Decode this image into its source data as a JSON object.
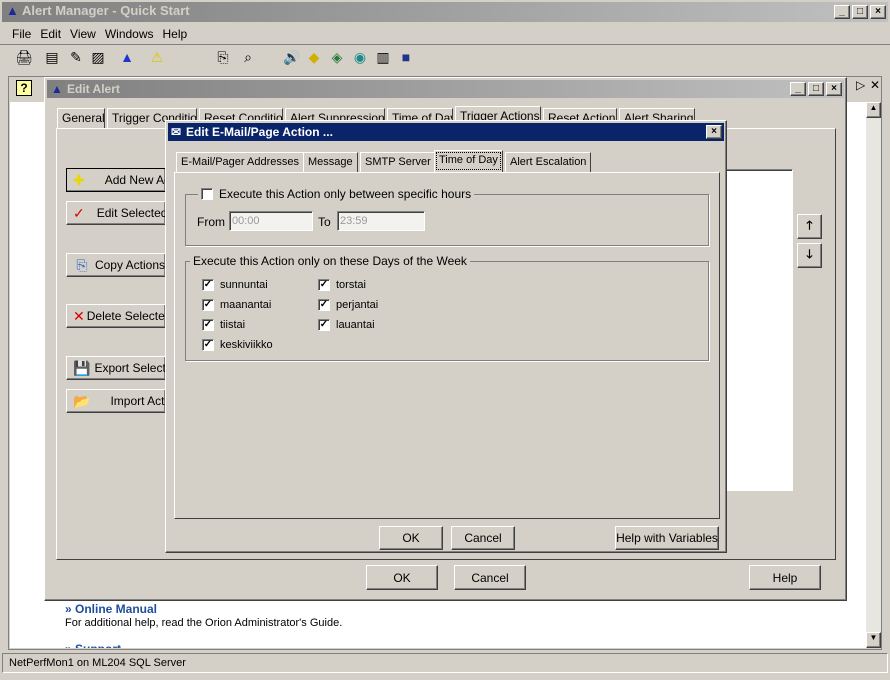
{
  "app": {
    "title": "Alert Manager - Quick Start",
    "menu": [
      "File",
      "Edit",
      "View",
      "Windows",
      "Help"
    ],
    "toolbar_icons": [
      "print-icon",
      "properties-icon",
      "edit-icon",
      "page-icon",
      "alert-blue-icon",
      "warning-icon",
      "copy-icon",
      "find-icon",
      "sound-icon",
      "road-sign-icon",
      "network-icon",
      "globe-icon",
      "document-icon",
      "terminal-icon"
    ]
  },
  "quickstart": {
    "online_manual": "» Online Manual",
    "online_manual_text": "For additional help, read the Orion Administrator's Guide.",
    "support": "» Support"
  },
  "status_bar": "NetPerfMon1 on ML204 SQL Server",
  "edit_alert": {
    "title": "Edit Alert",
    "tabs": [
      "General",
      "Trigger Condition",
      "Reset Condition",
      "Alert Suppression",
      "Time of Day",
      "Trigger Actions",
      "Reset Actions",
      "Alert Sharing"
    ],
    "active_tab": "Trigger Actions",
    "side_buttons": [
      "Add New Action",
      "Edit Selected Action",
      "Copy Actions",
      "Delete Selected Action",
      "Export Selected Actions",
      "Import Actions"
    ],
    "ok": "OK",
    "cancel": "Cancel",
    "help": "Help"
  },
  "email_dialog": {
    "title": "Edit E-Mail/Page Action ...",
    "tabs": [
      "E-Mail/Pager Addresses",
      "Message",
      "SMTP Server",
      "Time of Day",
      "Alert Escalation"
    ],
    "active_tab": "Time of Day",
    "hours_label": "Execute this Action only between specific hours",
    "hours_checked": false,
    "from_label": "From",
    "from_value": "00:00",
    "to_label": "To",
    "to_value": "23:59",
    "days_label": "Execute this Action only on these Days of the Week",
    "days": [
      {
        "label": "sunnuntai",
        "checked": true
      },
      {
        "label": "maanantai",
        "checked": true
      },
      {
        "label": "tiistai",
        "checked": true
      },
      {
        "label": "keskiviikko",
        "checked": true
      },
      {
        "label": "torstai",
        "checked": true
      },
      {
        "label": "perjantai",
        "checked": true
      },
      {
        "label": "lauantai",
        "checked": true
      }
    ],
    "ok": "OK",
    "cancel": "Cancel",
    "help_vars": "Help with Variables"
  },
  "colors": {
    "active_title": "#0a246a",
    "inactive_title": "#808080",
    "face": "#d4d0c8",
    "link": "#1f4e9c"
  }
}
